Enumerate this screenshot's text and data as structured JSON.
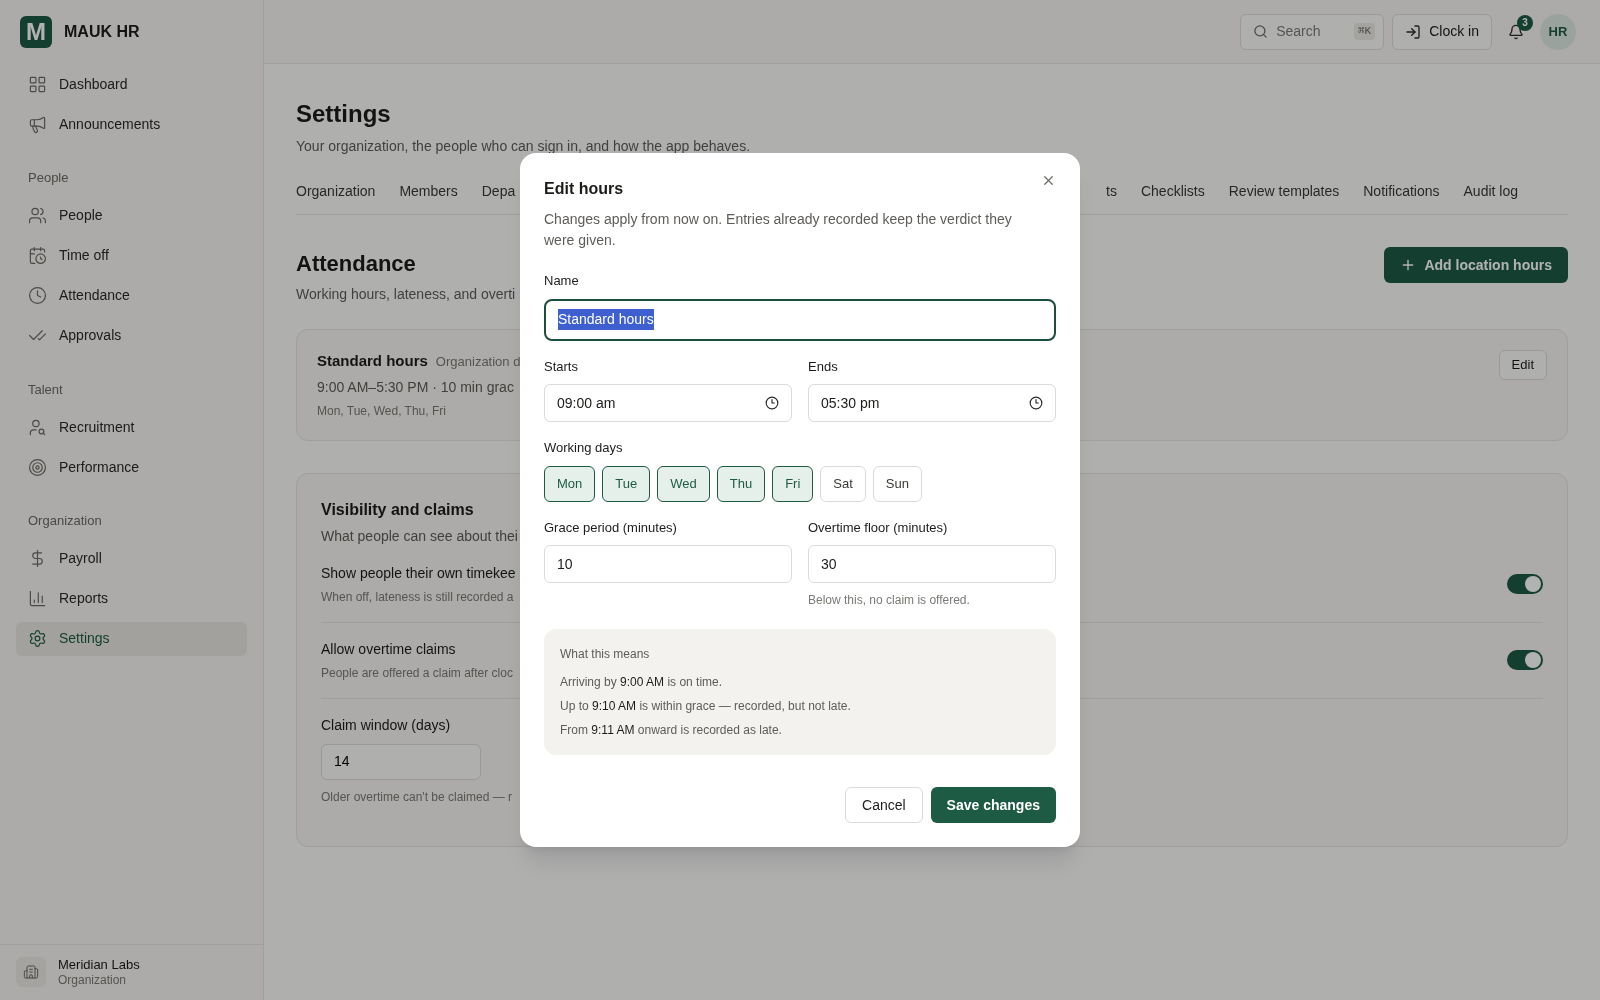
{
  "app": {
    "logo_letter": "M",
    "name": "MAUK HR"
  },
  "sidebar": {
    "sections": [
      {
        "items": [
          {
            "label": "Dashboard",
            "selected": false
          },
          {
            "label": "Announcements",
            "selected": false
          }
        ]
      },
      {
        "title": "People",
        "items": [
          {
            "label": "People",
            "selected": false
          },
          {
            "label": "Time off",
            "selected": false
          },
          {
            "label": "Attendance",
            "selected": false
          },
          {
            "label": "Approvals",
            "selected": false
          }
        ]
      },
      {
        "title": "Talent",
        "items": [
          {
            "label": "Recruitment",
            "selected": false
          },
          {
            "label": "Performance",
            "selected": false
          }
        ]
      },
      {
        "title": "Organization",
        "items": [
          {
            "label": "Payroll",
            "selected": false
          },
          {
            "label": "Reports",
            "selected": false
          },
          {
            "label": "Settings",
            "selected": true
          }
        ]
      }
    ],
    "org": {
      "name": "Meridian Labs",
      "subtitle": "Organization"
    }
  },
  "topbar": {
    "search": {
      "placeholder": "Search",
      "shortcut": "⌘K"
    },
    "clock_in": "Clock in",
    "notification_count": "3",
    "avatar": "HR"
  },
  "page": {
    "title": "Settings",
    "subtitle": "Your organization, the people who can sign in, and how the app behaves.",
    "tabs_left": [
      "Organization",
      "Members",
      "Depa"
    ],
    "tabs_right": [
      "ts",
      "Checklists",
      "Review templates",
      "Notifications",
      "Audit log"
    ]
  },
  "attendance": {
    "title": "Attendance",
    "subtitle": "Working hours, lateness, and overti",
    "add_button": "Add location hours",
    "hours_card": {
      "title": "Standard hours",
      "tag": "Organization d",
      "summary": "9:00 AM–5:30 PM · 10 min grac",
      "days": "Mon, Tue, Wed, Thu, Fri",
      "edit": "Edit"
    },
    "visibility": {
      "title": "Visibility and claims",
      "subtitle": "What people can see about thei",
      "rows": [
        {
          "kind": "toggle",
          "title": "Show people their own timekee",
          "description": "When off, lateness is still recorded a",
          "on": true
        },
        {
          "kind": "toggle",
          "title": "Allow overtime claims",
          "description": "People are offered a claim after cloc",
          "on": true
        },
        {
          "kind": "number",
          "title": "Claim window (days)",
          "value": "14",
          "description": "Older overtime can't be claimed — r"
        }
      ]
    }
  },
  "dialog": {
    "title": "Edit hours",
    "description": "Changes apply from now on. Entries already recorded keep the verdict they were given.",
    "name": {
      "label": "Name",
      "value": "Standard hours",
      "value_selected": true
    },
    "starts": {
      "label": "Starts",
      "value": "09:00 am"
    },
    "ends": {
      "label": "Ends",
      "value": "05:30 pm"
    },
    "working_days": {
      "label": "Working days",
      "days": [
        {
          "label": "Mon",
          "selected": true
        },
        {
          "label": "Tue",
          "selected": true
        },
        {
          "label": "Wed",
          "selected": true
        },
        {
          "label": "Thu",
          "selected": true
        },
        {
          "label": "Fri",
          "selected": true
        },
        {
          "label": "Sat",
          "selected": false
        },
        {
          "label": "Sun",
          "selected": false
        }
      ]
    },
    "grace": {
      "label": "Grace period (minutes)",
      "value": "10"
    },
    "overtime": {
      "label": "Overtime floor (minutes)",
      "value": "30",
      "hint": "Below this, no claim is offered."
    },
    "explainer": {
      "title": "What this means",
      "lines": [
        "Arriving by **9:00 AM** is on time.",
        "Up to **9:10 AM** is within grace — recorded, but not late.",
        "From **9:11 AM** onward is recorded as late."
      ]
    },
    "cancel": "Cancel",
    "save": "Save changes"
  }
}
